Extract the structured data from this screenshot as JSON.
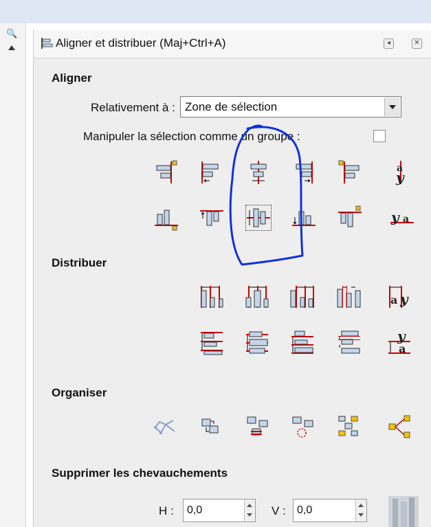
{
  "dialog": {
    "title": "Aligner et distribuer (Maj+Ctrl+A)",
    "align_section": "Aligner",
    "relative_label": "Relativement à :",
    "relative_value": "Zone de sélection",
    "group_label": "Manipuler la sélection comme un groupe :",
    "distribute_section": "Distribuer",
    "arrange_section": "Organiser",
    "overlap_section": "Supprimer les chevauchements",
    "h_label": "H :",
    "h_value": "0,0",
    "v_label": "V :",
    "v_value": "0,0"
  },
  "icons": {
    "align_row1": [
      "align-right-edge-to-left-anchor-icon",
      "align-left-edges-icon",
      "center-vertical-axis-icon",
      "align-right-edges-icon",
      "align-left-edge-to-right-anchor-icon",
      "align-baseline-text-icon"
    ],
    "align_row2": [
      "align-bottom-to-top-anchor-icon",
      "align-top-edges-icon",
      "center-horizontal-axis-icon",
      "align-bottom-edges-icon",
      "align-top-to-bottom-anchor-icon",
      "align-text-baseline-horizontal-icon"
    ],
    "distribute_row1": [
      "distribute-left-edges-icon",
      "distribute-centers-horizontal-icon",
      "distribute-right-edges-icon",
      "distribute-gaps-horizontal-icon",
      "distribute-baselines-horizontal-icon"
    ],
    "distribute_row2": [
      "distribute-top-edges-icon",
      "distribute-centers-vertical-icon",
      "distribute-bottom-edges-icon",
      "distribute-gaps-vertical-icon",
      "distribute-baselines-vertical-icon"
    ],
    "arrange_row": [
      "unclump-icon",
      "randomize-icon",
      "exchange-icon",
      "rotate-exchange-icon",
      "grid-arrange-icon",
      "tree-layout-icon"
    ]
  },
  "colors": {
    "accent_red": "#cc0000",
    "object_blue": "#c4d6ea",
    "anchor_yellow": "#f5c400",
    "annotation_blue": "#1030e0"
  }
}
